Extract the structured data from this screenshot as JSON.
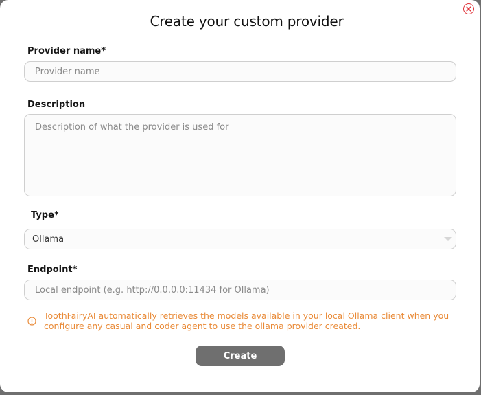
{
  "modal": {
    "title": "Create your custom provider"
  },
  "fields": {
    "provider_name": {
      "label": "Provider name*",
      "placeholder": "Provider name",
      "value": ""
    },
    "description": {
      "label": "Description",
      "placeholder": "Description of what the provider is used for",
      "value": ""
    },
    "type": {
      "label": "Type*",
      "selected": "Ollama"
    },
    "endpoint": {
      "label": "Endpoint*",
      "placeholder": "Local endpoint (e.g. http://0.0.0.0:11434 for Ollama)",
      "value": ""
    }
  },
  "info": {
    "icon": "info-circle-icon",
    "text": "ToothFairyAI automatically retrieves the models available in your local Ollama client when you configure any casual and coder agent to use the ollama provider created."
  },
  "actions": {
    "create_label": "Create",
    "close_icon": "close-icon"
  },
  "colors": {
    "backdrop": "#6f6f6f",
    "modal_bg": "#ffffff",
    "close_red": "#e0333a",
    "info_orange": "#e98a37",
    "button_bg": "#6f6f6f",
    "field_border": "#cfcfcf"
  }
}
